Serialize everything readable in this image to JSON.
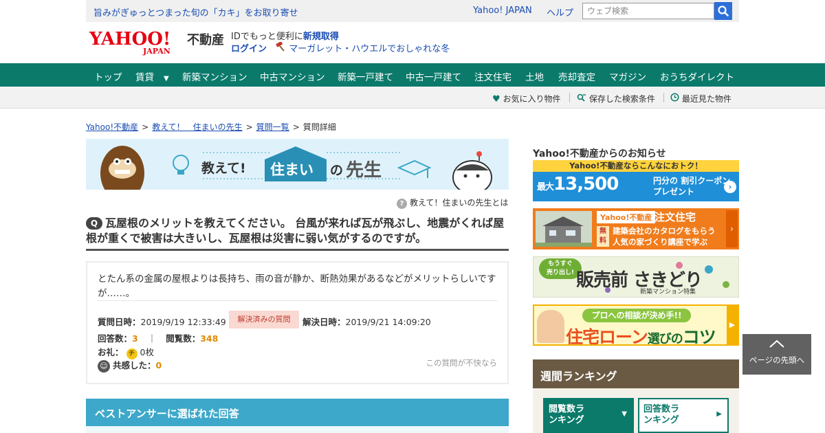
{
  "topbar": {
    "promo": "旨みがぎゅっとつまった旬の「カキ」をお取り寄せ",
    "yahoo_japan": "Yahoo! JAPAN",
    "help": "ヘルプ",
    "search_placeholder": "ウェブ検索"
  },
  "header": {
    "logo_yahoo": "YAHOO!",
    "logo_japan": "JAPAN",
    "logo_service": "不動産",
    "id_text": "IDでもっと便利に",
    "id_register": "新規取得",
    "login": "ログイン",
    "auction_link": "マーガレット・ハウエルでおしゃれな冬"
  },
  "nav": {
    "items": [
      "トップ",
      "賃貸",
      "新築マンション",
      "中古マンション",
      "新築一戸建て",
      "中古一戸建て",
      "注文住宅",
      "土地",
      "売却査定",
      "マガジン",
      "おうちダイレクト"
    ]
  },
  "subnav": {
    "favorites": "お気に入り物件",
    "saved_search": "保存した検索条件",
    "recent": "最近見た物件"
  },
  "breadcrumb": {
    "items": [
      "Yahoo!不動産",
      "教えて！　住まいの先生",
      "質問一覧",
      "質問詳細"
    ]
  },
  "banner": {
    "oshiete": "教えて!",
    "sumai": "住まい",
    "no": "の",
    "sensei": "先生"
  },
  "help_link": "教えて！住まいの先生とは",
  "question": {
    "badge": "Q",
    "title": "瓦屋根のメリットを教えてください。 台風が来れば瓦が飛ぶし、地震がくれば屋根が重くで被害は大きいし、瓦屋根は災害に弱い気がするのですが。",
    "body": "とたん系の金属の屋根よりは長持ち、雨の音が静か、断熱効果があるなどがメリットらしいですが……。",
    "asked_label": "質問日時：",
    "asked_value": "2019/9/19 12:33:49",
    "status": "解決済みの質問",
    "resolved_label": "解決日時：",
    "resolved_value": "2019/9/21 14:09:20",
    "answers_label": "回答数：",
    "answers_value": "3",
    "separator": "｜",
    "views_label": "閲覧数：",
    "views_value": "348",
    "reward_label": "お礼：",
    "coin_glyph": "チ",
    "reward_value": "0枚",
    "empathy_label": "共感した：",
    "empathy_value": "0",
    "report": "この質問が不快なら"
  },
  "best_answer_heading": "ベストアンサーに選ばれた回答",
  "sidebar": {
    "news_title": "Yahoo!不動産からのお知らせ",
    "ad1": {
      "band": "Yahoo!不動産ならこんなにおトク！",
      "prefix": "最大",
      "amount": "13,500",
      "unit": "円分の",
      "line1": "割引クーポン",
      "line2": "プレゼント"
    },
    "ad2": {
      "brand": "Yahoo!不動産",
      "product": "注文住宅",
      "free": "無料",
      "line1": "建築会社のカタログをもらう",
      "line2": "人気の家づくり講座で学ぶ"
    },
    "ad3": {
      "bubble_line1": "もうすぐ",
      "bubble_line2": "売り出し!",
      "main": "販売前 さきどり",
      "sub": "新築マンション特集"
    },
    "ad4": {
      "bubble": "プロへの相談が決め手!!",
      "main_a": "住宅ローン",
      "main_b": "選びの",
      "main_c": "コツ"
    },
    "ranking_title": "週間ランキング",
    "tab_views": "閲覧数ランキング",
    "tab_answers": "回答数ランキング"
  },
  "to_top": "ページの先頭へ",
  "colors": {
    "nav_green": "#0b7a6b",
    "link_blue": "#1a4db3",
    "best_answer_blue": "#3da8c9",
    "ranking_brown": "#6b5a43"
  }
}
